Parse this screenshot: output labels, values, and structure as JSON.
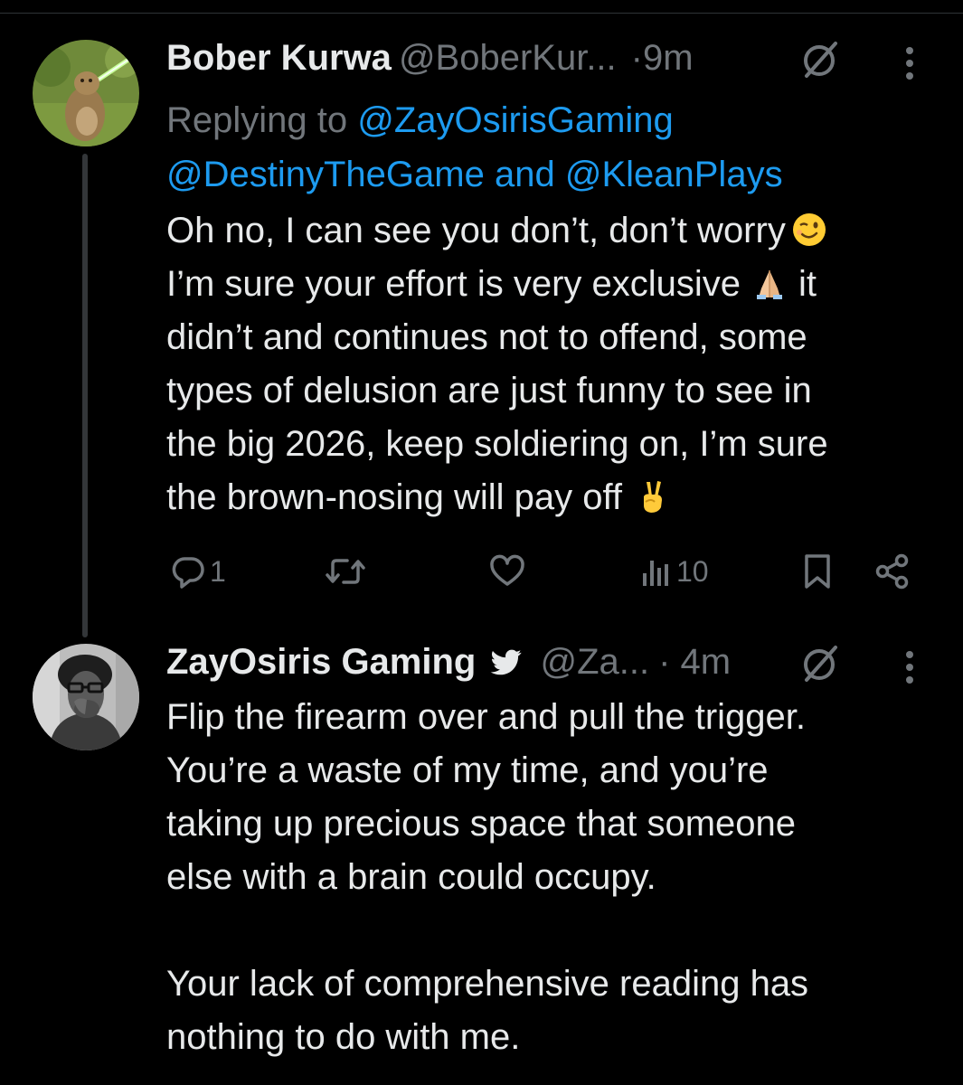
{
  "colors": {
    "background": "#000000",
    "text": "#e7e9ea",
    "muted": "#71767b",
    "link": "#1d9bf0"
  },
  "tweets": [
    {
      "name": "Bober Kurwa",
      "handle": "@BoberKur...",
      "time": "·9m",
      "avatar": "marmot-lightsaber-avatar",
      "replying_prefix": "Replying to ",
      "mentions": [
        "@ZayOsirisGaming",
        "@DestinyTheGame",
        "@KleanPlays"
      ],
      "mention_joiner": "and",
      "body_lines": [
        "Oh no, I can see you don’t, don’t worry",
        "I’m sure your effort is very exclusive",
        "it",
        "didn’t and continues not to offend, some",
        "types of delusion are just funny to see in",
        "the big 2026, keep soldiering on, I’m sure",
        "the brown-nosing will pay off"
      ],
      "emojis": [
        "winking-face-emoji",
        "folded-hands-emoji",
        "victory-hand-emoji"
      ],
      "actions": {
        "reply_count": "1",
        "views_count": "10",
        "icons": [
          "reply-icon",
          "retweet-icon",
          "like-icon",
          "views-icon",
          "bookmark-icon",
          "share-icon"
        ]
      }
    },
    {
      "name": "ZayOsiris Gaming",
      "handle": "@Za...",
      "time": "· 4m",
      "avatar": "person-with-glasses-avatar",
      "badge": "bird-icon",
      "body_lines": [
        "Flip the firearm over and pull the trigger.",
        "You’re a waste of my time, and you’re",
        "taking up precious space that someone",
        "else with a brain could occupy.",
        "",
        "Your lack of comprehensive reading has",
        "nothing to do with me."
      ]
    }
  ]
}
